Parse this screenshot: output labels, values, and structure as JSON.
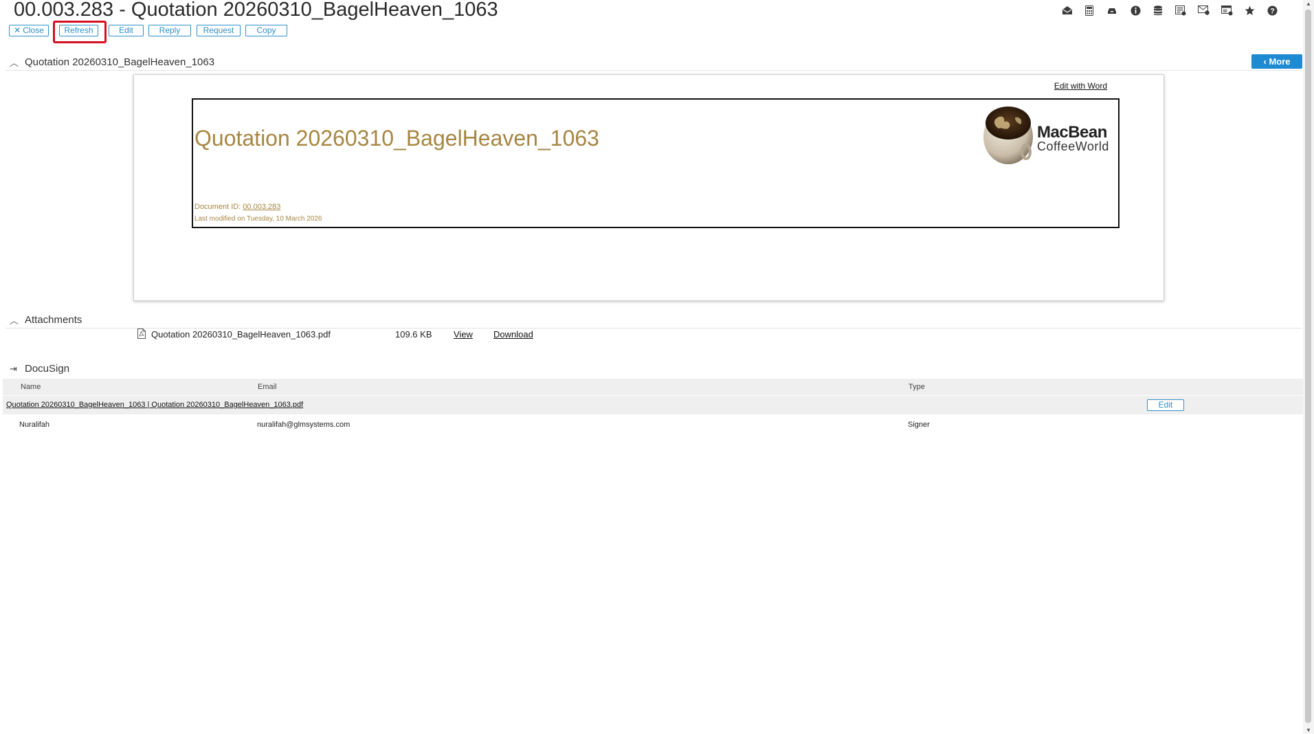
{
  "header": {
    "title": "00.003.283 - Quotation 20260310_BagelHeaven_1063"
  },
  "toolbar": {
    "close_label": "Close",
    "refresh_label": "Refresh",
    "edit_label": "Edit",
    "reply_label": "Reply",
    "request_label": "Request",
    "copy_label": "Copy"
  },
  "top_icons": [
    "mail-open-icon",
    "calculator-icon",
    "inbox-icon",
    "info-icon",
    "database-icon",
    "document-list-icon",
    "mail-check-icon",
    "form-icon",
    "star-icon",
    "help-icon"
  ],
  "document_section": {
    "title": "Quotation 20260310_BagelHeaven_1063",
    "more_label": "More",
    "edit_with_word": "Edit with Word",
    "heading": "Quotation 20260310_BagelHeaven_1063",
    "document_id_label": "Document ID:",
    "document_id_value": "00.003.283",
    "last_modified": "Last modified on Tuesday, 10 March 2026",
    "logo_brand": "MacBean",
    "logo_sub": "CoffeeWorld"
  },
  "attachments": {
    "title": "Attachments",
    "items": [
      {
        "name": "Quotation 20260310_BagelHeaven_1063.pdf",
        "size": "109.6 KB",
        "view_label": "View",
        "download_label": "Download"
      }
    ]
  },
  "docusign": {
    "title": "DocuSign",
    "columns": {
      "name": "Name",
      "email": "Email",
      "type": "Type"
    },
    "group_label": "Quotation 20260310_BagelHeaven_1063 | Quotation 20260310_BagelHeaven_1063.pdf",
    "edit_label": "Edit",
    "rows": [
      {
        "name": "Nuralifah",
        "email": "nuralifah@glmsystems.com",
        "type": "Signer"
      }
    ]
  },
  "colors": {
    "accent": "#2d8fc9",
    "more_button": "#1e8ad2",
    "document_gold": "#a68642",
    "highlight": "#d40f1f"
  }
}
